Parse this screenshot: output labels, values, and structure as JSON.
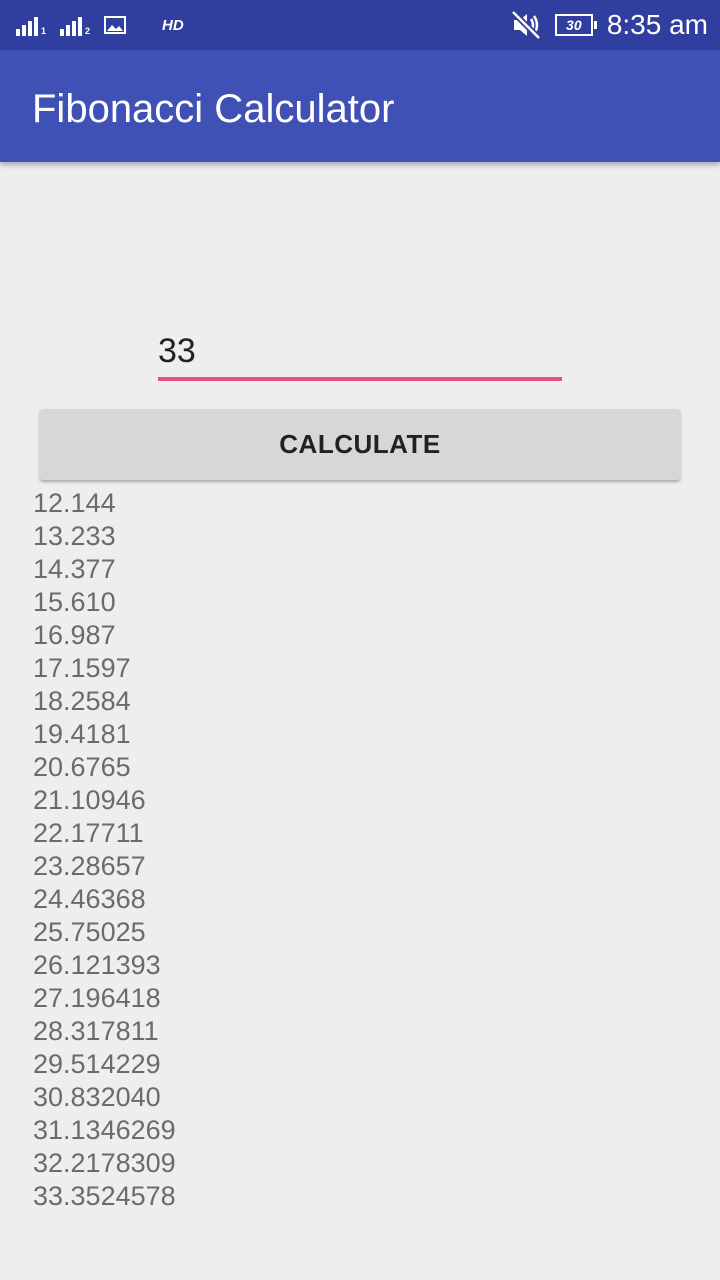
{
  "status_bar": {
    "sim1_label": "1",
    "sim2_label": "2",
    "hd_label": "HD",
    "battery_level": "30",
    "time": "8:35 am",
    "icons": [
      "signal-icon",
      "signal-icon",
      "gallery-icon",
      "hd-icon",
      "mute-icon",
      "battery-icon"
    ]
  },
  "app_bar": {
    "title": "Fibonacci Calculator",
    "color": "#3f51b5"
  },
  "form": {
    "input_value": "33",
    "button_label": "CALCULATE",
    "accent_color": "#e94d87"
  },
  "results": [
    "12.144",
    "13.233",
    "14.377",
    "15.610",
    "16.987",
    "17.1597",
    "18.2584",
    "19.4181",
    "20.6765",
    "21.10946",
    "22.17711",
    "23.28657",
    "24.46368",
    "25.75025",
    "26.121393",
    "27.196418",
    "28.317811",
    "29.514229",
    "30.832040",
    "31.1346269",
    "32.2178309",
    "33.3524578"
  ]
}
